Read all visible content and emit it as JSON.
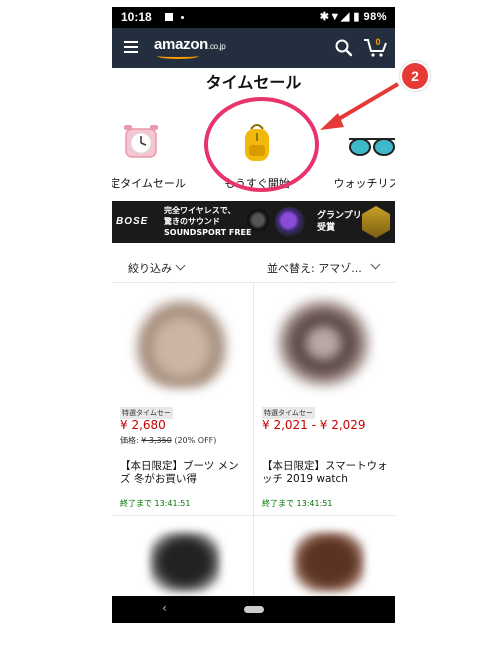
{
  "status_bar": {
    "time": "10:18",
    "battery": "98%",
    "icons": "✱▼◢ ▮"
  },
  "header": {
    "logo": "amazon",
    "logo_suffix": ".co.jp",
    "cart_count": "0"
  },
  "page_title": "タイムセール",
  "categories": [
    {
      "label": "限定タイムセール",
      "icon": "alarm-clock-icon"
    },
    {
      "label": "もうすぐ開始",
      "icon": "backpack-icon"
    },
    {
      "label": "ウォッチリスト",
      "icon": "sunglasses-icon"
    }
  ],
  "banner": {
    "brand": "BOSE",
    "line1": "完全ワイヤレスで、",
    "line2": "驚きのサウンド",
    "line3": "SOUNDSPORT FREE",
    "award1": "グランプリ",
    "award2": "受賞"
  },
  "filters": {
    "filter_label": "絞り込み",
    "sort_label": "並べ替え: アマゾ..."
  },
  "products": [
    {
      "badge": "特選タイムセー",
      "price": "¥ 2,680",
      "list_prefix": "価格: ",
      "list_price": "¥ 3,350",
      "discount": " (20% OFF)",
      "name": "【本日限定】ブーツ メンズ 冬がお買い得",
      "timer": "終了まで 13:41:51"
    },
    {
      "badge": "特選タイムセー",
      "price": "¥ 2,021 - ¥ 2,029",
      "name": "【本日限定】スマートウォッチ 2019 watch",
      "timer": "終了まで 13:41:51"
    }
  ],
  "annotation": {
    "step_number": "2"
  },
  "colors": {
    "header_bg": "#232f3e",
    "accent": "#ff9900",
    "price": "#c40000",
    "timer": "#007600",
    "annotation": "#e8336b"
  }
}
